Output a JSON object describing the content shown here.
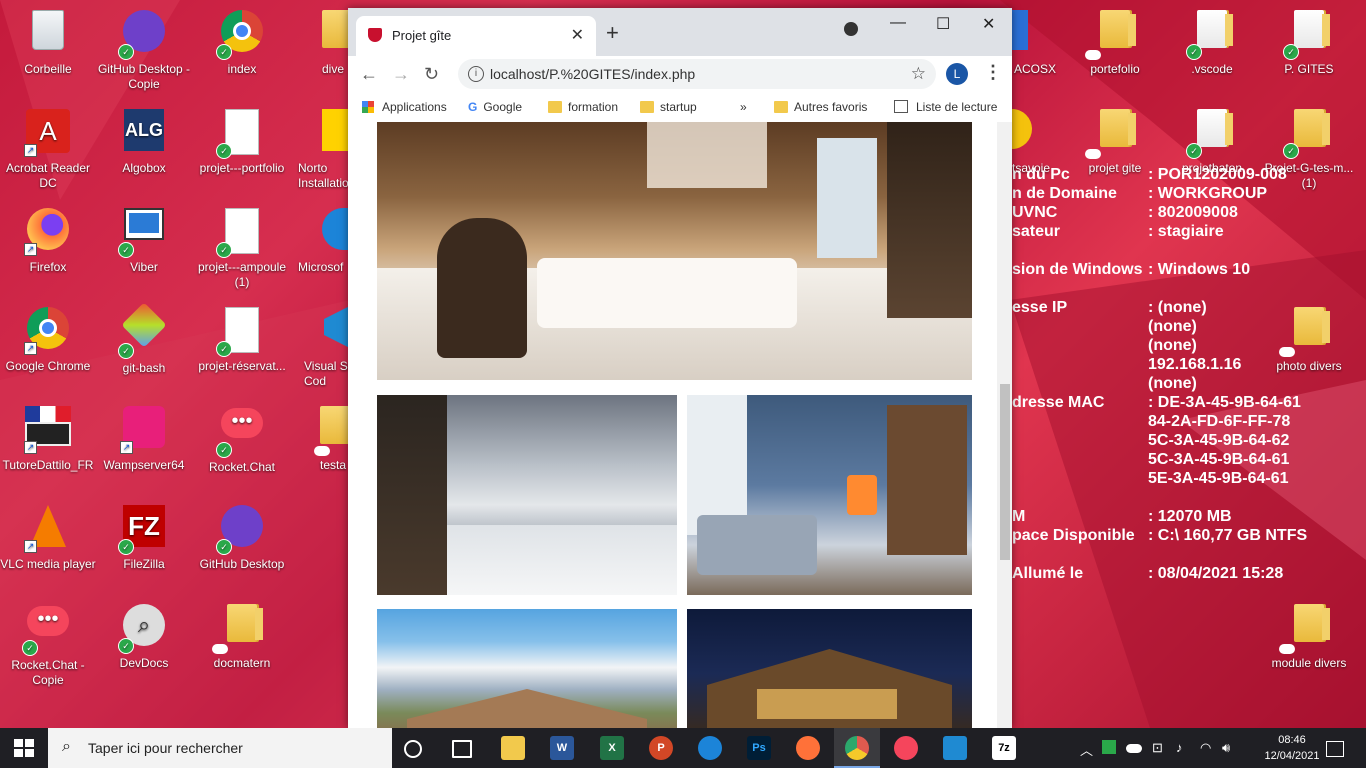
{
  "desktop": {
    "icons": [
      {
        "label": "Corbeille"
      },
      {
        "label": "GitHub Desktop - Copie"
      },
      {
        "label": "index"
      },
      {
        "label": "dive"
      },
      {
        "label": "Acrobat Reader DC"
      },
      {
        "label": "Algobox"
      },
      {
        "label": "projet---portfolio"
      },
      {
        "label": "Norto Installatio"
      },
      {
        "label": "Firefox"
      },
      {
        "label": "Viber"
      },
      {
        "label": "projet---ampoule (1)"
      },
      {
        "label": "Microsof"
      },
      {
        "label": "Google Chrome"
      },
      {
        "label": "git-bash"
      },
      {
        "label": "projet-réservat..."
      },
      {
        "label": "Visual St Cod"
      },
      {
        "label": "TutoreDattilo_FR"
      },
      {
        "label": "Wampserver64"
      },
      {
        "label": "Rocket.Chat"
      },
      {
        "label": "testa"
      },
      {
        "label": "VLC media player"
      },
      {
        "label": "FileZilla"
      },
      {
        "label": "GitHub Desktop"
      },
      {
        "label": "Rocket.Chat - Copie"
      },
      {
        "label": "DevDocs"
      },
      {
        "label": "docmatern"
      },
      {
        "label": "ACOSX"
      },
      {
        "label": "portefolio"
      },
      {
        "label": ".vscode"
      },
      {
        "label": "P. GITES"
      },
      {
        "label": "tsavoie"
      },
      {
        "label": "projet gite"
      },
      {
        "label": "projetbaton"
      },
      {
        "label": "Projet-G-tes-m... (1)"
      },
      {
        "label": "photo divers"
      },
      {
        "label": "module divers"
      }
    ]
  },
  "sysinfo": [
    {
      "k": "n du Pc",
      "v": ": POR1202009-008"
    },
    {
      "k": "n de Domaine",
      "v": ": WORKGROUP"
    },
    {
      "k": "UVNC",
      "v": ": 802009008"
    },
    {
      "k": "sateur",
      "v": ": stagiaire"
    },
    {
      "k": "",
      "v": ""
    },
    {
      "k": "sion de Windows",
      "v": ": Windows 10"
    },
    {
      "k": "",
      "v": ""
    },
    {
      "k": "esse IP",
      "v": ": (none)"
    },
    {
      "k": "",
      "v": "(none)"
    },
    {
      "k": "",
      "v": "(none)"
    },
    {
      "k": "",
      "v": "192.168.1.16"
    },
    {
      "k": "",
      "v": "(none)"
    },
    {
      "k": "dresse MAC",
      "v": ": DE-3A-45-9B-64-61"
    },
    {
      "k": "",
      "v": "84-2A-FD-6F-FF-78"
    },
    {
      "k": "",
      "v": "5C-3A-45-9B-64-62"
    },
    {
      "k": "",
      "v": "5C-3A-45-9B-64-61"
    },
    {
      "k": "",
      "v": "5E-3A-45-9B-64-61"
    },
    {
      "k": "",
      "v": ""
    },
    {
      "k": "M",
      "v": ": 12070 MB"
    },
    {
      "k": "pace Disponible",
      "v": ": C:\\ 160,77 GB NTFS"
    },
    {
      "k": "",
      "v": ""
    },
    {
      "k": "Allumé le",
      "v": ": 08/04/2021 15:28"
    }
  ],
  "browser": {
    "tab_title": "Projet gîte",
    "url": "localhost/P.%20GITES/index.php",
    "avatar_letter": "L",
    "bookmarks": {
      "apps": "Applications",
      "google": "Google",
      "formation": "formation",
      "startup": "startup",
      "more": "»",
      "autres": "Autres favoris",
      "reading": "Liste de lecture"
    }
  },
  "taskbar": {
    "search_placeholder": "Taper ici pour rechercher",
    "time": "08:46",
    "date": "12/04/2021"
  }
}
